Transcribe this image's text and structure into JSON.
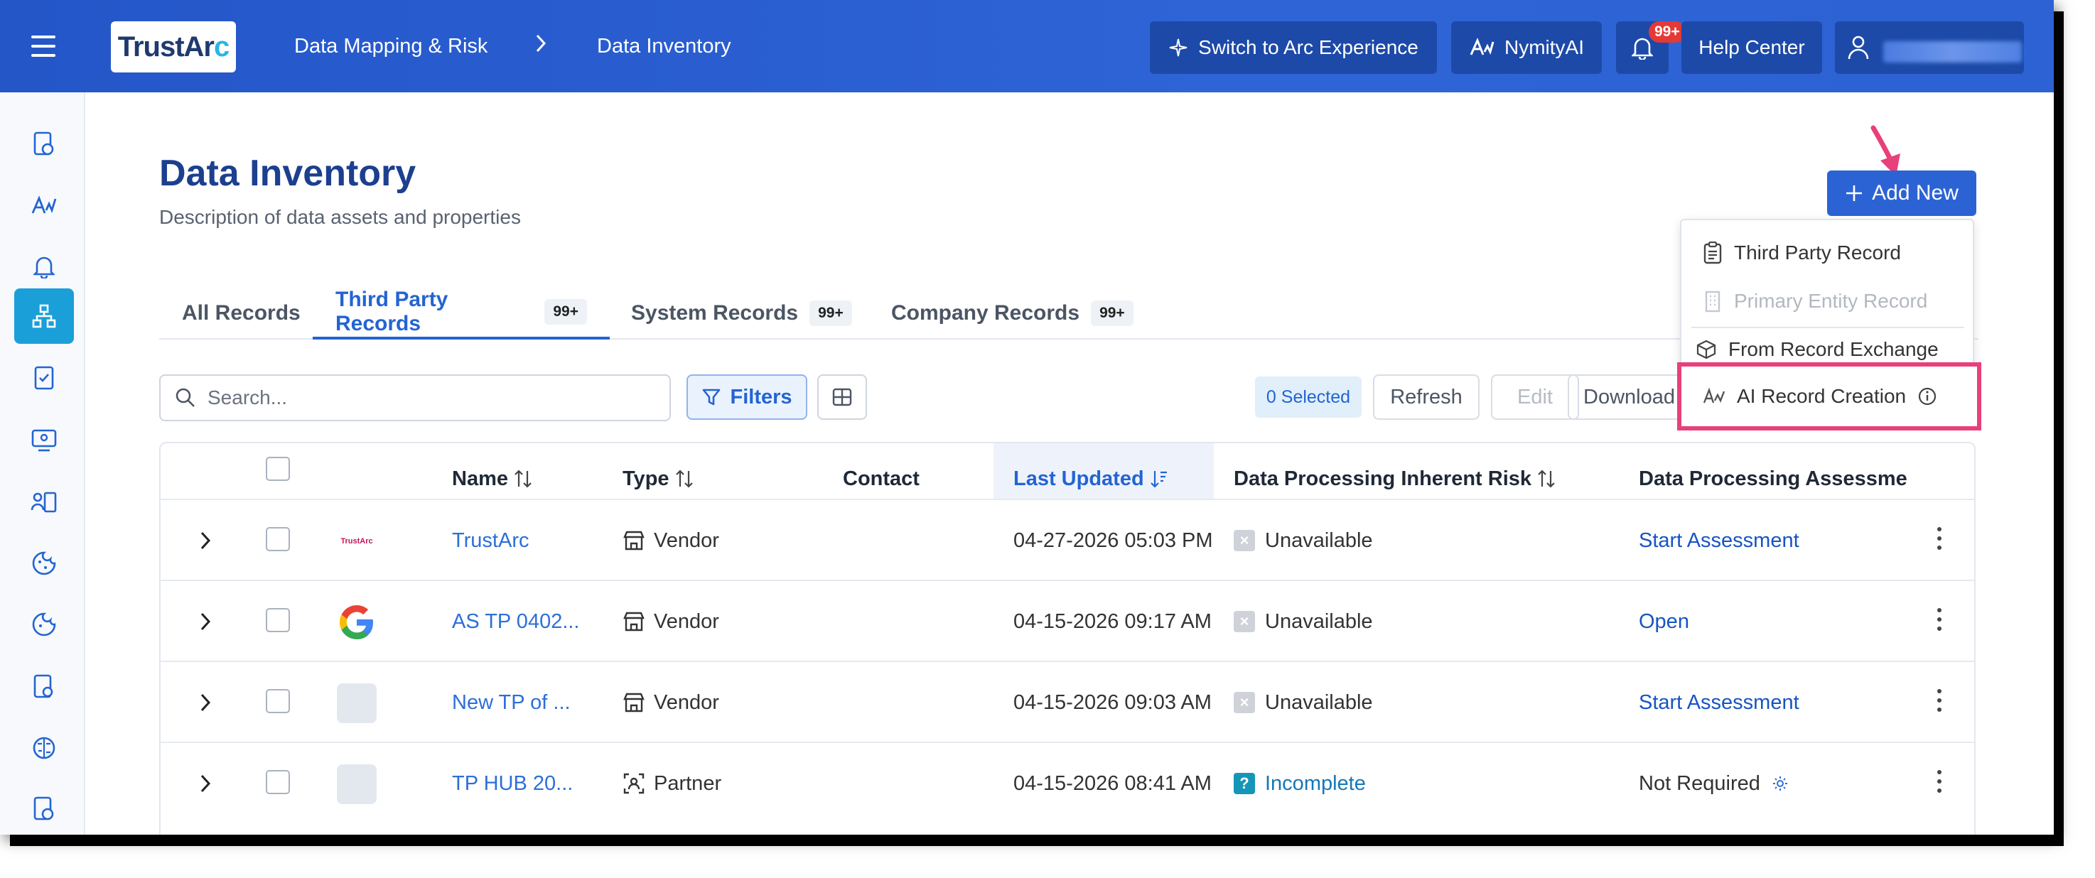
{
  "topbar": {
    "logo_text_a": "TrustAr",
    "logo_text_b": "c",
    "breadcrumb_1": "Data Mapping & Risk",
    "breadcrumb_2": "Data Inventory",
    "switch_label": "Switch to Arc Experience",
    "nymity_label": "NymityAI",
    "notif_count": "99+",
    "help_label": "Help Center"
  },
  "page": {
    "title": "Data Inventory",
    "description": "Description of data assets and properties",
    "add_new_label": "Add New"
  },
  "tabs": [
    {
      "label": "All Records",
      "badge": ""
    },
    {
      "label": "Third Party Records",
      "badge": "99+"
    },
    {
      "label": "System Records",
      "badge": "99+"
    },
    {
      "label": "Company Records",
      "badge": "99+"
    }
  ],
  "toolbar": {
    "search_placeholder": "Search...",
    "filters_label": "Filters",
    "selected_label": "0 Selected",
    "refresh_label": "Refresh",
    "edit_label": "Edit",
    "download_label": "Download"
  },
  "dropdown": {
    "items": [
      {
        "label": "Third Party Record",
        "enabled": true
      },
      {
        "label": "Primary Entity Record",
        "enabled": false
      },
      {
        "label": "From Record Exchange",
        "enabled": true
      },
      {
        "label": "AI Record Creation",
        "enabled": true
      }
    ]
  },
  "table": {
    "headers": {
      "name": "Name",
      "type": "Type",
      "contact": "Contact",
      "last_updated": "Last Updated",
      "risk": "Data Processing Inherent Risk",
      "assessment": "Data Processing Assessme"
    },
    "rows": [
      {
        "logo": "TrustArc",
        "name": "TrustArc",
        "type": "Vendor",
        "updated": "04-27-2026 05:03 PM",
        "risk": "Unavailable",
        "risk_state": "gray",
        "assessment": "Start Assessment",
        "assessment_link": true
      },
      {
        "logo": "G",
        "name": "AS TP 0402...",
        "type": "Vendor",
        "updated": "04-15-2026 09:17 AM",
        "risk": "Unavailable",
        "risk_state": "gray",
        "assessment": "Open",
        "assessment_link": true
      },
      {
        "logo": "",
        "name": "New TP of ...",
        "type": "Vendor",
        "updated": "04-15-2026 09:03 AM",
        "risk": "Unavailable",
        "risk_state": "gray",
        "assessment": "Start Assessment",
        "assessment_link": true
      },
      {
        "logo": "",
        "name": "TP HUB 20...",
        "type": "Partner",
        "updated": "04-15-2026 08:41 AM",
        "risk": "Incomplete",
        "risk_state": "teal",
        "assessment": "Not Required",
        "assessment_link": false
      }
    ]
  },
  "colors": {
    "brand_blue": "#2c63d4",
    "highlight_pink": "#e8407b",
    "sidebar_active": "#1b9fd8"
  }
}
